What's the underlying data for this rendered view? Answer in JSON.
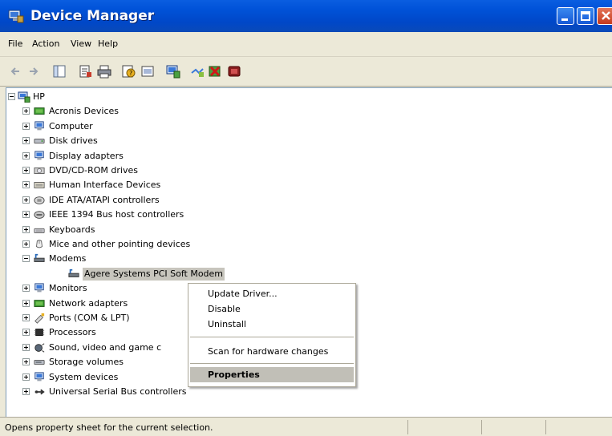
{
  "window": {
    "title": "Device Manager"
  },
  "menu": [
    "File",
    "Action",
    "View",
    "Help"
  ],
  "toolbar": [
    "back-icon",
    "forward-icon",
    "console-tree-icon",
    "properties-icon",
    "print-icon",
    "help-icon",
    "view-icon",
    "scan-hardware-icon",
    "update-driver-icon",
    "uninstall-icon",
    "disable-icon"
  ],
  "tree": {
    "root": "HP",
    "items": [
      {
        "label": "Acronis Devices",
        "icon": "acronis-icon"
      },
      {
        "label": "Computer",
        "icon": "computer-icon"
      },
      {
        "label": "Disk drives",
        "icon": "disk-drive-icon"
      },
      {
        "label": "Display adapters",
        "icon": "display-adapter-icon"
      },
      {
        "label": "DVD/CD-ROM drives",
        "icon": "dvd-drive-icon"
      },
      {
        "label": "Human Interface Devices",
        "icon": "hid-icon"
      },
      {
        "label": "IDE ATA/ATAPI controllers",
        "icon": "ide-controller-icon"
      },
      {
        "label": "IEEE 1394 Bus host controllers",
        "icon": "ieee1394-icon"
      },
      {
        "label": "Keyboards",
        "icon": "keyboard-icon"
      },
      {
        "label": "Mice and other pointing devices",
        "icon": "mouse-icon"
      },
      {
        "label": "Modems",
        "icon": "modem-icon",
        "expanded": true
      },
      {
        "label": "Agere Systems PCI Soft Modem",
        "icon": "modem-icon",
        "child": true,
        "selected": true
      },
      {
        "label": "Monitors",
        "icon": "monitor-icon"
      },
      {
        "label": "Network adapters",
        "icon": "network-adapter-icon"
      },
      {
        "label": "Ports (COM & LPT)",
        "icon": "port-icon"
      },
      {
        "label": "Processors",
        "icon": "processor-icon"
      },
      {
        "label": "Sound, video and game c",
        "icon": "sound-icon"
      },
      {
        "label": "Storage volumes",
        "icon": "storage-volume-icon"
      },
      {
        "label": "System devices",
        "icon": "system-device-icon"
      },
      {
        "label": "Universal Serial Bus controllers",
        "icon": "usb-icon"
      }
    ]
  },
  "context_menu": {
    "items": [
      "Update Driver...",
      "Disable",
      "Uninstall",
      "Scan for hardware changes",
      "Properties"
    ],
    "active": "Properties"
  },
  "status": "Opens property sheet for the current selection."
}
